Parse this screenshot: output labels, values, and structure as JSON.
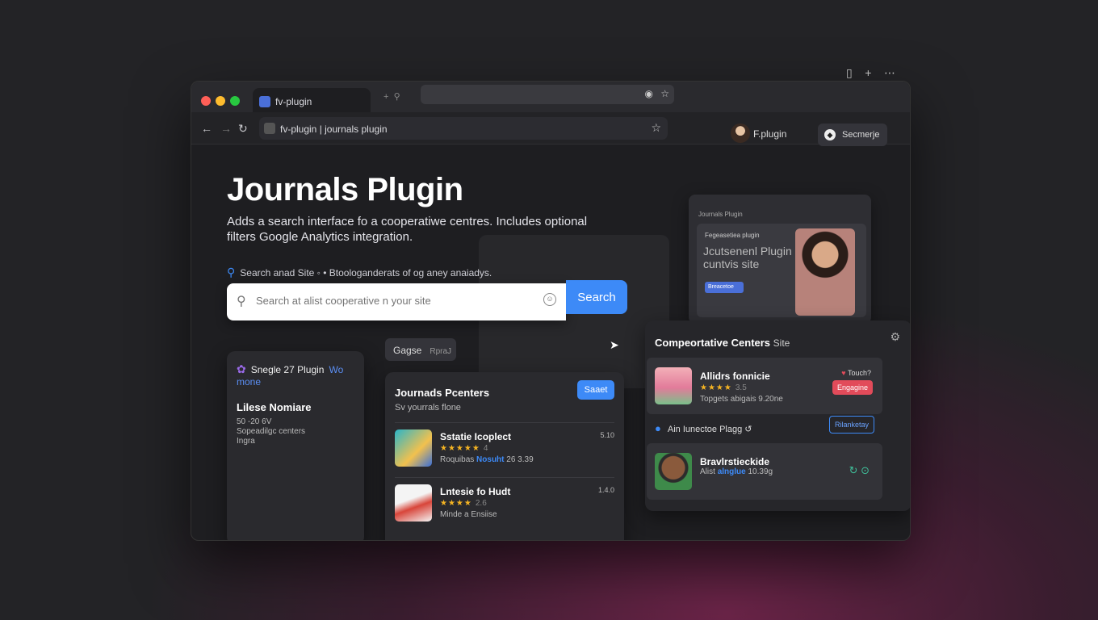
{
  "window": {
    "tab_label": "fv-plugin",
    "url": "fv-plugin | journals plugin",
    "profile_name": "F.plugin",
    "account_pill": "Secmerje"
  },
  "hero": {
    "title": "Journals Plugin",
    "description": "Adds a search interface fo a cooperatiwe centres. Includes optional filters Google Analytics integration.",
    "helper": "Search anad Site  ◦ •  Btoologanderats of og aney anaiadys.",
    "search_placeholder": "Search at alist cooperative n your site",
    "search_button": "Search"
  },
  "left_card": {
    "brand": "Snegle 27 Plugin",
    "accent": "Wo mone",
    "title": "Lilese Nomiare",
    "lines": [
      "50 -20 6V",
      "Sopeadilgc centers",
      "Ingra"
    ]
  },
  "chip": {
    "label": "Gagse",
    "secondary": "RpraJ"
  },
  "mid_card": {
    "title": "Journads Pcenters",
    "subtitle": "Sv yourrals flone",
    "button": "Saaet",
    "items": [
      {
        "name": "Sstatie Icoplect",
        "rating": "★★★★★",
        "rating_count": "4",
        "meta_prefix": "Roquibas",
        "meta_link": "Nosuht",
        "meta_suffix": "26 3.39",
        "num": "5.10"
      },
      {
        "name": "Lntesie fo Hudt",
        "rating": "★★★★",
        "rating_count": "2.6",
        "meta_prefix": "Minde a Ensiise",
        "meta_link": "",
        "meta_suffix": "",
        "num": "1.4.0"
      }
    ]
  },
  "preview": {
    "bar_label": "Journals Plugin",
    "small_label": "Fegeasetiea plugin",
    "title": "Jcutsenenl Plugin cuntvis site",
    "button": "Breacetoe"
  },
  "right_card": {
    "title": "Compeortative Centers",
    "title_suffix": "Site",
    "items": [
      {
        "name": "Allidrs fonnicie",
        "rating": "★★★★",
        "rating_count": "3.5",
        "meta_prefix": "Topgets abigais",
        "meta_link": "",
        "meta_suffix": "9.20ne",
        "top": "Touch?",
        "badge": "Engagine"
      },
      {
        "name": "Bravlrstieckide",
        "meta_prefix": "Alist",
        "meta_link": "alnglue",
        "meta_suffix": "10.39g"
      }
    ],
    "midrow": "Ain Iunectoe Plagg",
    "midrow_icon": "↺",
    "outline_button": "Rilanketay"
  },
  "colors": {
    "accent": "#3d8af7",
    "danger": "#e24b5a",
    "success": "#3fbf9a"
  }
}
